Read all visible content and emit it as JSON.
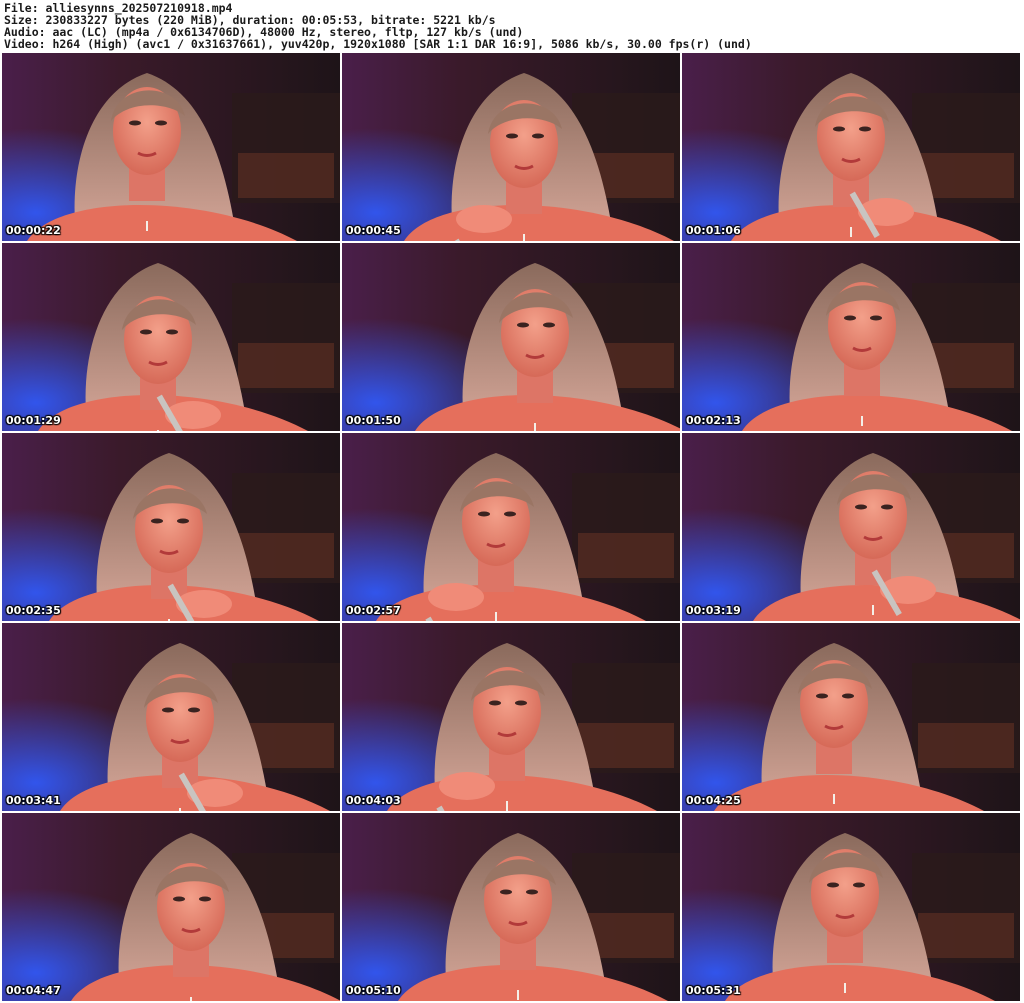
{
  "header": {
    "file": "File: alliesynns_202507210918.mp4",
    "size": "Size: 230833227 bytes (220 MiB), duration: 00:05:53, bitrate: 5221 kb/s",
    "audio": "Audio: aac (LC) (mp4a / 0x6134706D), 48000 Hz, stereo, fltp, 127 kb/s (und)",
    "video": "Video: h264 (High) (avc1 / 0x31637661), yuv420p, 1920x1080 [SAR 1:1 DAR 16:9], 5086 kb/s, 30.00 fps(r) (und)"
  },
  "thumbnails": [
    {
      "timestamp": "00:00:22"
    },
    {
      "timestamp": "00:00:45"
    },
    {
      "timestamp": "00:01:06"
    },
    {
      "timestamp": "00:01:29"
    },
    {
      "timestamp": "00:01:50"
    },
    {
      "timestamp": "00:02:13"
    },
    {
      "timestamp": "00:02:35"
    },
    {
      "timestamp": "00:02:57"
    },
    {
      "timestamp": "00:03:19"
    },
    {
      "timestamp": "00:03:41"
    },
    {
      "timestamp": "00:04:03"
    },
    {
      "timestamp": "00:04:25"
    },
    {
      "timestamp": "00:04:47"
    },
    {
      "timestamp": "00:05:10"
    },
    {
      "timestamp": "00:05:31"
    }
  ],
  "colors": {
    "background": "#ffffff",
    "scene_dark": "#2a1620",
    "skin": "#e98a78",
    "hair": "#b88f82",
    "accent_red": "#ff5a4a",
    "accent_blue": "#2f5bff"
  }
}
